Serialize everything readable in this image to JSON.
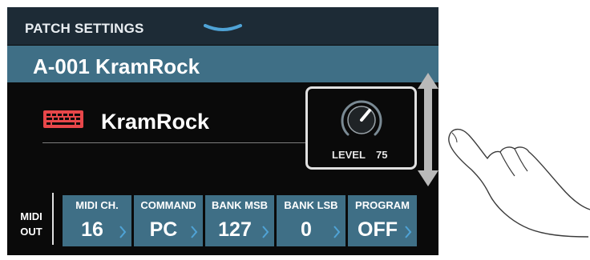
{
  "header": {
    "title": "PATCH SETTINGS"
  },
  "patch": {
    "name": "A-001 KramRock"
  },
  "instrument": {
    "name": "KramRock",
    "icon": "keyboard-icon",
    "icon_color": "#e8474a"
  },
  "level": {
    "label": "LEVEL",
    "value": "75",
    "value_fraction": 0.75
  },
  "midi_out": {
    "label_line1": "MIDI",
    "label_line2": "OUT"
  },
  "params": [
    {
      "label": "MIDI CH.",
      "value": "16"
    },
    {
      "label": "COMMAND",
      "value": "PC"
    },
    {
      "label": "BANK MSB",
      "value": "127"
    },
    {
      "label": "BANK LSB",
      "value": "0"
    },
    {
      "label": "PROGRAM",
      "value": "OFF"
    }
  ],
  "colors": {
    "header_bg": "#1d2b36",
    "accent": "#3f6f86",
    "chevron": "#4fa3d6",
    "screen_bg": "#0a0a0a"
  }
}
